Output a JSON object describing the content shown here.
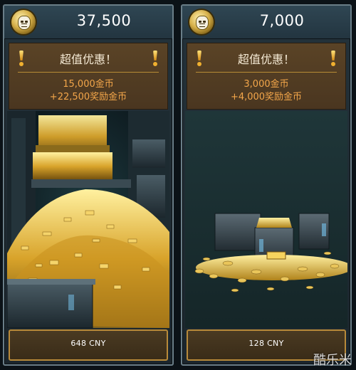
{
  "packs": [
    {
      "amount": "37,500",
      "offer_title": "超值优惠！",
      "base_coins": "15,000金币",
      "bonus_coins": "+22,500奖励金币",
      "price": "648 CNY"
    },
    {
      "amount": "7,000",
      "offer_title": "超值优惠！",
      "base_coins": "3,000金币",
      "bonus_coins": "+4,000奖励金币",
      "price": "128 CNY"
    }
  ],
  "icons": {
    "currency": "skull-coin-icon",
    "highlight": "exclamation-icon"
  },
  "colors": {
    "offer_text": "#f3a64a",
    "price_border": "#b88a3a",
    "gold": "#d6b04a"
  },
  "watermark": "酷乐米"
}
